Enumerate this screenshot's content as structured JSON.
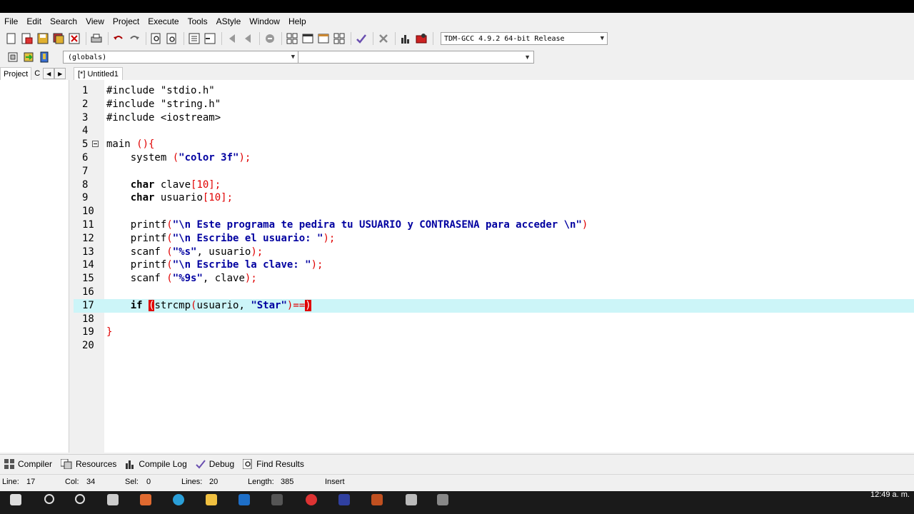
{
  "menu": [
    "File",
    "Edit",
    "Search",
    "View",
    "Project",
    "Execute",
    "Tools",
    "AStyle",
    "Window",
    "Help"
  ],
  "toolbar": {
    "compiler": "TDM-GCC 4.9.2 64-bit Release",
    "scope": "(globals)",
    "icons": [
      "new-file-icon",
      "open-icon",
      "save-icon",
      "save-all-icon",
      "close-icon",
      "print-icon",
      "undo-icon",
      "redo-icon",
      "find-icon",
      "replace-icon",
      "indent-icon",
      "unindent-icon",
      "goto-back-icon",
      "goto-forward-icon",
      "bookmark-icon",
      "window-grid-icon",
      "window-icon",
      "window-tile-icon",
      "window-split-icon",
      "check-icon",
      "stop-icon",
      "chart-icon",
      "debug-icon"
    ]
  },
  "left_panel": {
    "tabs": [
      "Project",
      "C"
    ]
  },
  "editor": {
    "tab_label": "[*] Untitled1",
    "lines": [
      "1",
      "2",
      "3",
      "4",
      "5",
      "6",
      "7",
      "8",
      "9",
      "10",
      "11",
      "12",
      "13",
      "14",
      "15",
      "16",
      "17",
      "18",
      "19",
      "20"
    ],
    "code": {
      "l1": "#include \"stdio.h\"",
      "l2": "#include \"string.h\"",
      "l3": "#include <iostream>",
      "l5_a": "main ",
      "l5_b": "(){",
      "l6_a": "    system ",
      "l6_b": "(",
      "l6_c": "\"color 3f\"",
      "l6_d": ");",
      "l8_a": "    ",
      "l8_kw": "char",
      "l8_b": " clave",
      "l8_c": "[10];",
      "l9_a": "    ",
      "l9_kw": "char",
      "l9_b": " usuario",
      "l9_c": "[10];",
      "l11_a": "    printf",
      "l11_b": "(",
      "l11_c": "\"\\n Este programa te pedira tu USUARIO y CONTRASENA para acceder \\n\"",
      "l11_d": ")",
      "l12_a": "    printf",
      "l12_b": "(",
      "l12_c": "\"\\n Escribe el usuario: \"",
      "l12_d": ");",
      "l13_a": "    scanf ",
      "l13_b": "(",
      "l13_c": "\"%s\"",
      "l13_d": ", usuario",
      "l13_e": ");",
      "l14_a": "    printf",
      "l14_b": "(",
      "l14_c": "\"\\n Escribe la clave: \"",
      "l14_d": ");",
      "l15_a": "    scanf ",
      "l15_b": "(",
      "l15_c": "\"%9s\"",
      "l15_d": ", clave",
      "l15_e": ");",
      "l17_a": "    ",
      "l17_kw": "if",
      "l17_sp": " ",
      "l17_b": "(",
      "l17_c": "strcmp",
      "l17_d": "(",
      "l17_e": "usuario, ",
      "l17_f": "\"Star\"",
      "l17_g": ")==",
      "l17_h": ")",
      "l19": "}"
    }
  },
  "bottom_tabs": [
    "Compiler",
    "Resources",
    "Compile Log",
    "Debug",
    "Find Results"
  ],
  "status": {
    "line_label": "Line:",
    "line_value": "17",
    "col_label": "Col:",
    "col_value": "34",
    "sel_label": "Sel:",
    "sel_value": "0",
    "lines_label": "Lines:",
    "lines_value": "20",
    "length_label": "Length:",
    "length_value": "385",
    "mode": "Insert"
  },
  "taskbar": {
    "clock": "12:49 a. m."
  },
  "colors": {
    "current_line": "#ccf5f8",
    "string": "#0000a0",
    "symbol": "#e00000",
    "bracket_match": "#e00000"
  }
}
